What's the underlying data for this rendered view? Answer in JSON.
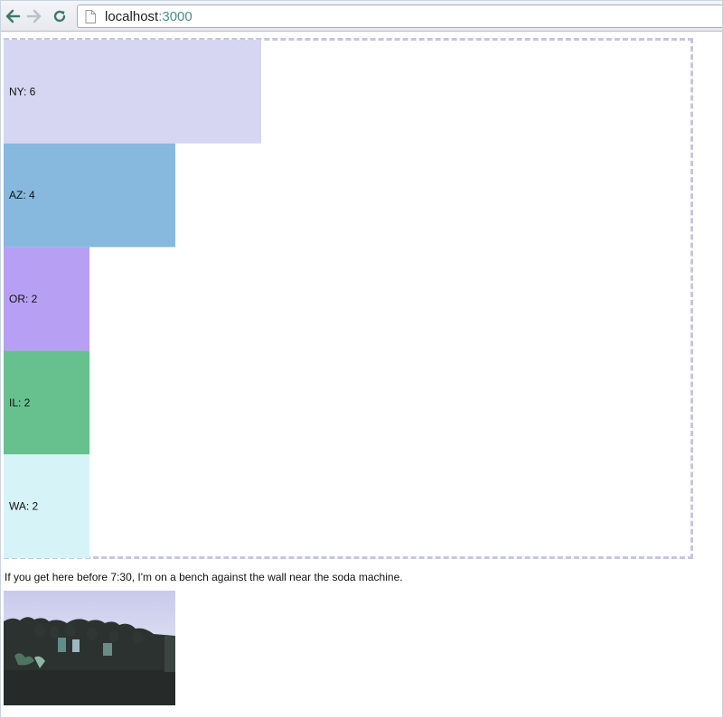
{
  "browser": {
    "url_host": "localhost",
    "url_port": ":3000",
    "icons": {
      "back": "arrow-left-icon",
      "forward": "arrow-right-icon",
      "reload": "reload-icon",
      "page": "page-icon"
    }
  },
  "page": {
    "note": "If you get here before 7:30, I'm on a bench against the wall near the soda machine.",
    "photo": "group-photo-outdoors"
  },
  "chart_data": {
    "type": "bar",
    "orientation": "horizontal",
    "categories": [
      "NY",
      "AZ",
      "OR",
      "IL",
      "WA"
    ],
    "values": [
      6,
      4,
      2,
      2,
      2
    ],
    "labels": [
      "NY: 6",
      "AZ: 4",
      "OR: 2",
      "IL: 2",
      "WA: 2"
    ],
    "colors": [
      "#d6d6f2",
      "#86b9dd",
      "#b7a0f4",
      "#66c18e",
      "#d6f4f8"
    ],
    "xlim": [
      0,
      16
    ],
    "title": "",
    "xlabel": "",
    "ylabel": "",
    "grid": false,
    "legend": "none"
  }
}
